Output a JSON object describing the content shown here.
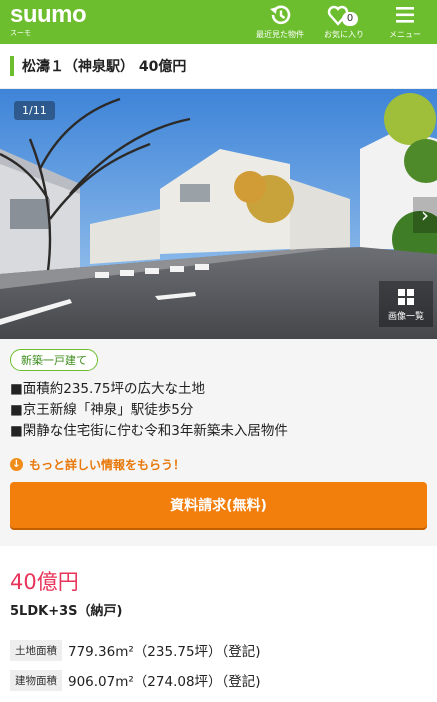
{
  "header": {
    "logo": "suumo",
    "logo_sub": "スーモ",
    "recent_label": "最近見た物件",
    "favorites_label": "お気に入り",
    "favorites_count": "0",
    "menu_label": "メニュー",
    "brand_color": "#6cbe2e"
  },
  "property": {
    "title": "松濤１（神泉駅） 40億円",
    "photo_counter": "1/11",
    "gallery_label": "画像一覧",
    "type_tag": "新築一戸建て",
    "points": [
      "■面積約235.75坪の広大な土地",
      "■京王新線「神泉」駅徒歩5分",
      "■閑静な住宅街に佇む令和3年新築未入居物件"
    ],
    "more_info": "もっと詳しい情報をもらう！",
    "cta_label": "資料請求(無料)",
    "price": "40億円",
    "layout": "5LDK+3S（納戸)",
    "specs": [
      {
        "label": "土地面積",
        "value": "779.36m²（235.75坪）（登記)"
      },
      {
        "label": "建物面積",
        "value": "906.07m²（274.08坪）（登記)"
      }
    ],
    "accent_orange": "#f27e0c",
    "price_color": "#e8345a"
  }
}
